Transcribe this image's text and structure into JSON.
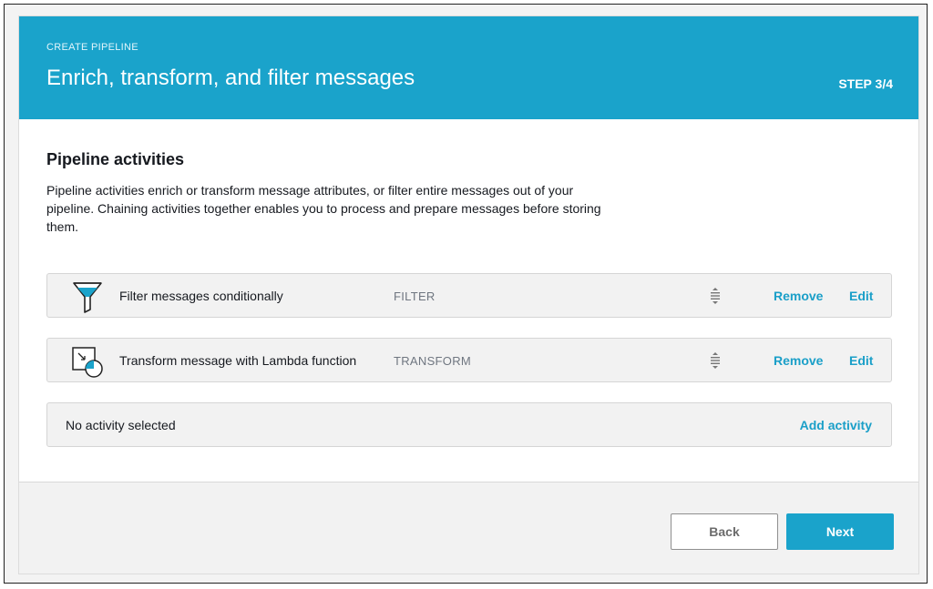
{
  "header": {
    "crumb": "CREATE PIPELINE",
    "title": "Enrich, transform, and filter messages",
    "step": "STEP 3/4",
    "color": "#1aa3cb"
  },
  "section": {
    "title": "Pipeline activities",
    "description": "Pipeline activities enrich or transform message attributes, or filter entire messages out of your pipeline. Chaining activities together enables you to process and prepare messages before storing them."
  },
  "activities": [
    {
      "icon": "filter-funnel-icon",
      "label": "Filter messages conditionally",
      "type": "FILTER",
      "remove": "Remove",
      "edit": "Edit"
    },
    {
      "icon": "transform-lambda-icon",
      "label": "Transform message with Lambda function",
      "type": "TRANSFORM",
      "remove": "Remove",
      "edit": "Edit"
    }
  ],
  "selection": {
    "status": "No activity selected",
    "add_label": "Add activity"
  },
  "footer": {
    "back_label": "Back",
    "next_label": "Next"
  }
}
